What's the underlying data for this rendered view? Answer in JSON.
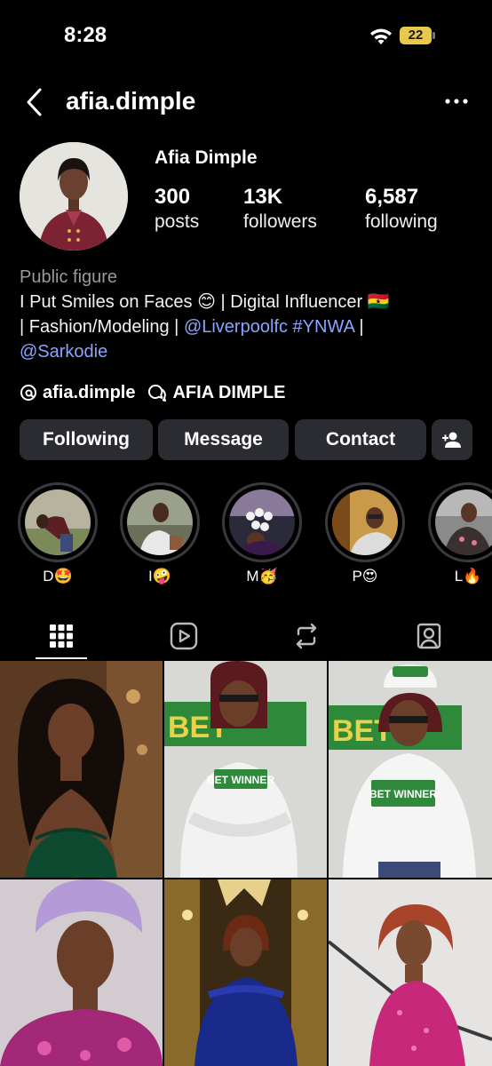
{
  "status_bar": {
    "time": "8:28",
    "battery": "22"
  },
  "header": {
    "username": "afia.dimple"
  },
  "profile": {
    "display_name": "Afia Dimple",
    "stats": [
      {
        "value": "300",
        "label": "posts"
      },
      {
        "value": "13K",
        "label": "followers"
      },
      {
        "value": "6,587",
        "label": "following"
      }
    ],
    "category": "Public figure",
    "bio_line1": "I Put Smiles on Faces 😊 | Digital Influencer 🇬🇭",
    "bio_line2_prefix": "| Fashion/Modeling | ",
    "bio_link1": "@Liverpoolfc",
    "bio_link2": "#YNWA",
    "bio_line2_suffix": " |",
    "bio_link3": "@Sarkodie",
    "threads_handle": "afia.dimple",
    "channel_name": "AFIA DIMPLE"
  },
  "buttons": {
    "following": "Following",
    "message": "Message",
    "contact": "Contact"
  },
  "highlights": [
    {
      "label": "D🤩"
    },
    {
      "label": "I🤪"
    },
    {
      "label": "M🥳"
    },
    {
      "label": "P😍"
    },
    {
      "label": "L🔥"
    }
  ],
  "tabs": [
    "grid-icon",
    "reels-icon",
    "reposts-icon",
    "tagged-icon"
  ],
  "grid_posts": [
    {
      "badge": ""
    },
    {
      "badge": "BET WINNER"
    },
    {
      "badge": "BET WINNER"
    },
    {
      "badge": ""
    },
    {
      "badge": ""
    },
    {
      "badge": ""
    }
  ]
}
